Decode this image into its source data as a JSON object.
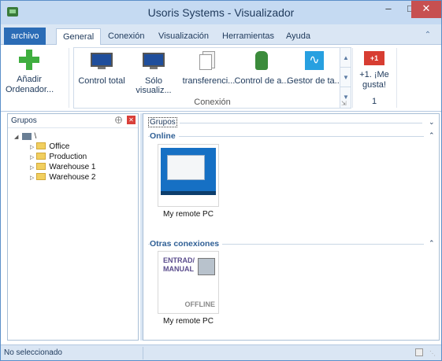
{
  "window": {
    "title": "Usoris Systems - Visualizador"
  },
  "tabs": {
    "file": "archivo",
    "items": [
      "General",
      "Conexión",
      "Visualización",
      "Herramientas",
      "Ayuda"
    ]
  },
  "ribbon": {
    "add": "Añadir Ordenador...",
    "gallery": [
      "Control total",
      "Sólo visualiz...",
      "transferenci...",
      "Control de a...",
      "Gestor de ta..."
    ],
    "group_label": "Conexión",
    "gplus_label": "+1",
    "like": "+1. ¡Me gusta!",
    "like_count": "1"
  },
  "left_pane": {
    "title": "Grupos",
    "tree": [
      "Office",
      "Production",
      "Warehouse 1",
      "Warehouse 2"
    ]
  },
  "main_pane": {
    "breadcrumb": "Grupos",
    "online_label": "Online",
    "online_tile": "My remote PC",
    "other_label": "Otras conexiones",
    "manual_text": "ENTRAD/\nMANUAL",
    "offline_text": "OFFLINE",
    "other_tile": "My remote PC"
  },
  "status": {
    "text": "No seleccionado"
  }
}
